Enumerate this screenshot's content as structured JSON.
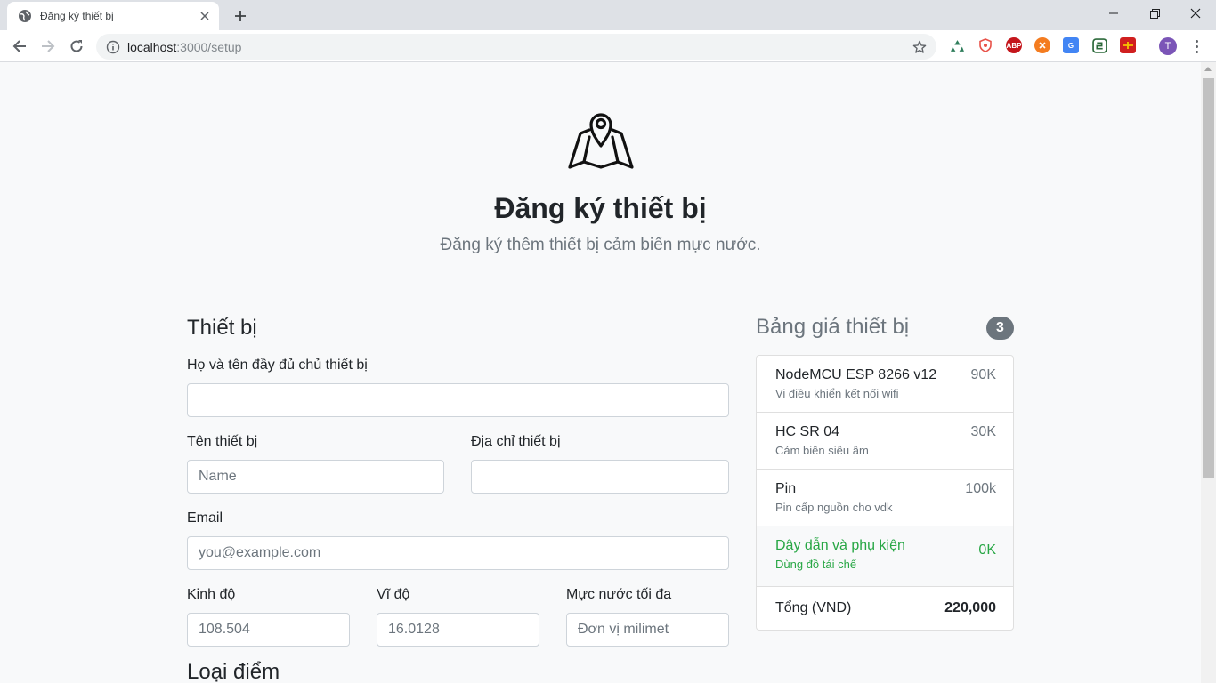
{
  "browser": {
    "tab_title": "Đăng ký thiết bị",
    "url_host": "localhost",
    "url_rest": ":3000/setup",
    "profile_initial": "T"
  },
  "page": {
    "title": "Đăng ký thiết bị",
    "lead": "Đăng ký thêm thiết bị cảm biến mực nước."
  },
  "form": {
    "section_title": "Thiết bị",
    "owner_label": "Họ và tên đầy đủ chủ thiết bị",
    "owner_value": "",
    "device_name_label": "Tên thiết bị",
    "device_name_placeholder": "Name",
    "device_address_label": "Địa chỉ thiết bị",
    "device_address_value": "",
    "email_label": "Email",
    "email_placeholder": "you@example.com",
    "longitude_label": "Kinh độ",
    "longitude_placeholder": "108.504",
    "latitude_label": "Vĩ độ",
    "latitude_placeholder": "16.0128",
    "max_level_label": "Mực nước tối đa",
    "max_level_placeholder": "Đơn vị milimet",
    "next_section_title": "Loại điểm"
  },
  "cart": {
    "title": "Bảng giá thiết bị",
    "count": "3",
    "items": [
      {
        "name": "NodeMCU ESP 8266 v12",
        "desc": "Vi điều khiển kết nối wifi",
        "price": "90K"
      },
      {
        "name": "HC SR 04",
        "desc": "Cảm biến siêu âm",
        "price": "30K"
      },
      {
        "name": "Pin",
        "desc": "Pin cấp nguồn cho vdk",
        "price": "100k"
      },
      {
        "name": "Dây dẫn và phụ kiện",
        "desc": "Dùng đồ tái chế",
        "price": "0K"
      }
    ],
    "total_label": "Tổng (VND)",
    "total_value": "220,000"
  },
  "colors": {
    "muted": "#6c757d",
    "success": "#28a745",
    "page_bg": "#f8f9fa"
  },
  "icons": {
    "hero": "map-marker-icon",
    "extensions": [
      "recycle-icon",
      "shield-icon",
      "abp-icon",
      "orange-circle-icon",
      "translate-icon",
      "extension-2-icon",
      "red-extension-icon"
    ]
  }
}
